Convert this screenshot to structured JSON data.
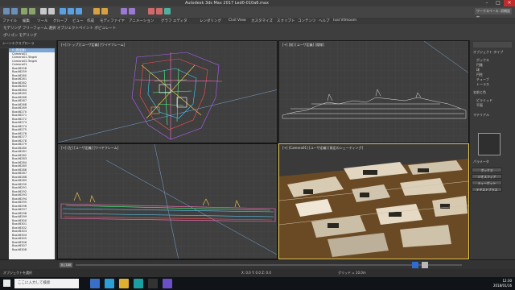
{
  "window": {
    "title": "Autodesk 3ds Max 2017    Led0-010a6.max",
    "minimize": "–",
    "maximize": "□",
    "close": "✕"
  },
  "toolbar": {
    "workspace": "ワークスペース: 初期設定"
  },
  "menu": [
    "ファイル",
    "編集",
    "ツール",
    "グループ",
    "ビュー",
    "作成",
    "モディファイヤ",
    "アニメーション",
    "グラフ エディタ",
    "レンダリング",
    "Civil View",
    "カスタマイズ",
    "スクリプト",
    "コンテンツ",
    "ヘルプ",
    "Ival Vilmoom"
  ],
  "ribbon": {
    "row1": "モデリング    フリーフォーム    選択    オブジェクトペイント    ポピュレート",
    "row2": "ポリゴン モデリング"
  },
  "scene_explorer": {
    "header": "シーンエクスプローラ",
    "rows": [
      "0 (既定値)",
      "Camera01",
      "Camera01.Target",
      "Camera02.Target",
      "Camera01",
      "Box46258",
      "Box46259",
      "Box46260",
      "Box46261",
      "Box46262",
      "Box46263",
      "Box46264",
      "Box46265",
      "Box46266",
      "Box46267",
      "Box46268",
      "Box46269",
      "Box46270",
      "Box46271",
      "Box46272",
      "Box46273",
      "Box46274",
      "Box46275",
      "Box46276",
      "Box46277",
      "Box46278",
      "Box46279",
      "Box46280",
      "Box46281",
      "Box46282",
      "Box46283",
      "Box46284",
      "Box46285",
      "Box46286",
      "Box46287",
      "Box46288",
      "Box46289",
      "Box46290",
      "Box46291",
      "Box46292",
      "Box46293",
      "Box46294",
      "Box46295",
      "Box46296",
      "Box46297",
      "Box46298",
      "Box46299",
      "Box46300",
      "Box46301",
      "Box46302",
      "Box46303",
      "Box46304",
      "Box46305",
      "Box46306",
      "Box46307",
      "Box46308"
    ],
    "footer": "ワークスペース: 既定"
  },
  "viewports": {
    "top": "[+] [トップ] [ユーザ定義] [ワイヤフレーム]",
    "front": "[+] [前] [ユーザ定義] [隠線]",
    "left": "[+] [左] [ユーザ定義] [ワイヤフレーム]",
    "camera": "[+] [Camera01] [ユーザ定義] [既定のシェーディング]"
  },
  "command_panel": {
    "rollouts": [
      "オブジェクト タイプ",
      "名前と色",
      "マテリアル",
      "パラメータ"
    ],
    "items": [
      "ボックス",
      "円錐",
      "球",
      "円柱",
      "チューブ",
      "トーラス",
      "ピラミッド",
      "平面"
    ],
    "buttons": [
      "ボックス",
      "ジオスフィア",
      "ティーポット",
      "テキストプラス"
    ]
  },
  "timeline": {
    "frame": "0 / 100"
  },
  "status": {
    "coords": "X: 0.0    Y: 0.0    Z: 0.0",
    "grid": "グリッド = 10.0m",
    "prompt": "オブジェクトを選択"
  },
  "taskbar": {
    "search": "ここに入力して検索",
    "time": "12:30",
    "date": "2018/01/16"
  },
  "colors": {
    "accent": "#e6c84a",
    "ground": "#6a4a25"
  }
}
